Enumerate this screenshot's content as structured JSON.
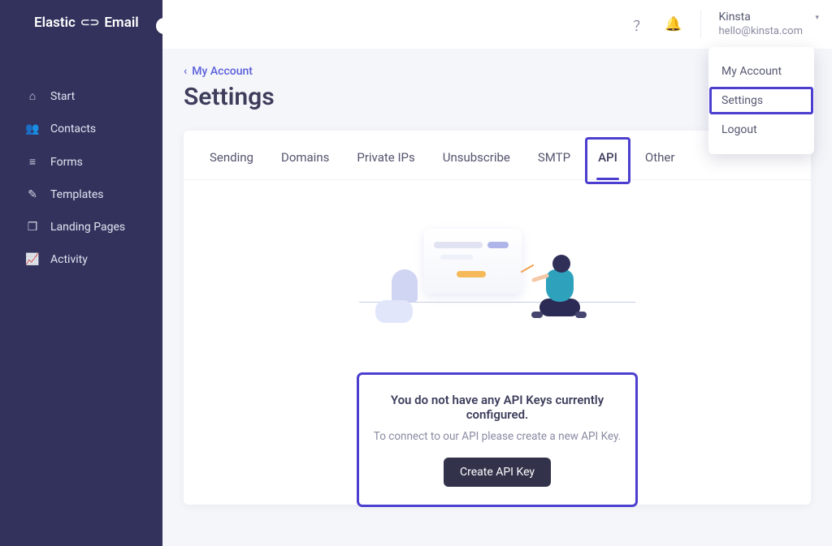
{
  "brand": {
    "name_left": "Elastic",
    "name_right": "Email"
  },
  "sidebar": {
    "items": [
      {
        "label": "Start"
      },
      {
        "label": "Contacts"
      },
      {
        "label": "Forms"
      },
      {
        "label": "Templates"
      },
      {
        "label": "Landing Pages"
      },
      {
        "label": "Activity"
      }
    ]
  },
  "topbar": {
    "account_name": "Kinsta",
    "account_email": "hello@kinsta.com"
  },
  "dropdown": {
    "items": [
      {
        "label": "My Account"
      },
      {
        "label": "Settings"
      },
      {
        "label": "Logout"
      }
    ],
    "highlighted_index": 1
  },
  "breadcrumb": {
    "label": "My Account"
  },
  "page_title": "Settings",
  "tabs": [
    {
      "label": "Sending"
    },
    {
      "label": "Domains"
    },
    {
      "label": "Private IPs"
    },
    {
      "label": "Unsubscribe"
    },
    {
      "label": "SMTP"
    },
    {
      "label": "API"
    },
    {
      "label": "Other"
    }
  ],
  "active_tab_index": 5,
  "empty_state": {
    "title": "You do not have any API Keys currently configured.",
    "subtitle": "To connect to our API please create a new API Key.",
    "button": "Create API Key"
  }
}
